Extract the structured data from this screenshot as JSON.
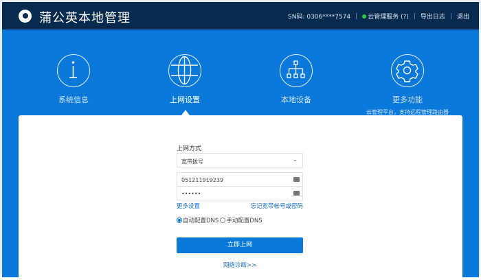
{
  "header": {
    "title": "蒲公英本地管理",
    "sn": "SN码: 0306****7574",
    "cloud_service": "云管理服务 (?)",
    "export_log": "导出日志",
    "logout": "退出",
    "status_color": "#2ecc40"
  },
  "nav": [
    {
      "label": "系统信息",
      "icon": "info-icon"
    },
    {
      "label": "上网设置",
      "icon": "globe-icon",
      "active": true
    },
    {
      "label": "本地设备",
      "icon": "network-tree-icon"
    },
    {
      "label": "更多功能",
      "icon": "gear-icon",
      "sub": "云管理平台，支持远程管理路由器"
    }
  ],
  "form": {
    "mode_label": "上网方式",
    "mode_value": "宽带拨号",
    "account": "051211919239",
    "password": "••••••",
    "more_settings": "更多设置",
    "forgot": "忘记宽带帐号或密码",
    "dns_auto": "自动配置DNS",
    "dns_manual": "手动配置DNS",
    "dns_selected": "auto",
    "connect": "立即上网",
    "diagnose": "网络诊断>>"
  }
}
